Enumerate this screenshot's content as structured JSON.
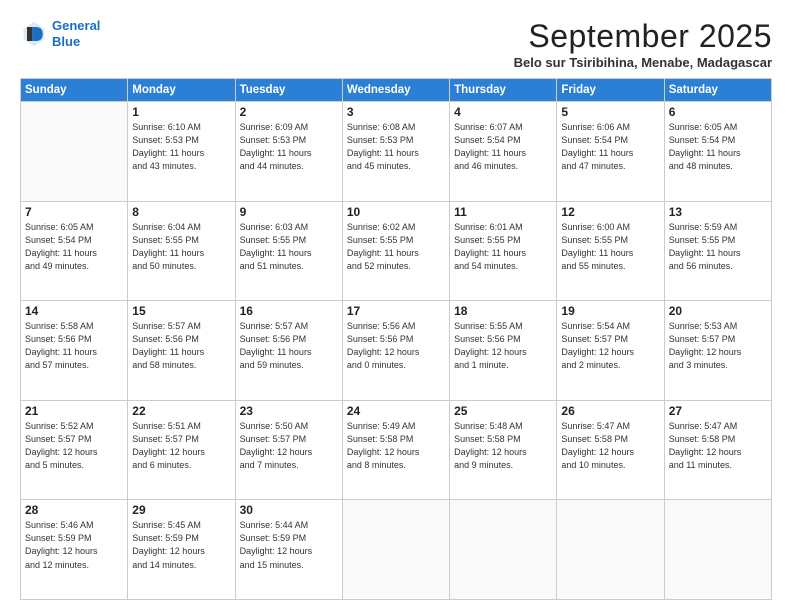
{
  "logo": {
    "line1": "General",
    "line2": "Blue"
  },
  "title": "September 2025",
  "location": "Belo sur Tsiribihina, Menabe, Madagascar",
  "headers": [
    "Sunday",
    "Monday",
    "Tuesday",
    "Wednesday",
    "Thursday",
    "Friday",
    "Saturday"
  ],
  "weeks": [
    [
      {
        "day": "",
        "info": ""
      },
      {
        "day": "1",
        "info": "Sunrise: 6:10 AM\nSunset: 5:53 PM\nDaylight: 11 hours\nand 43 minutes."
      },
      {
        "day": "2",
        "info": "Sunrise: 6:09 AM\nSunset: 5:53 PM\nDaylight: 11 hours\nand 44 minutes."
      },
      {
        "day": "3",
        "info": "Sunrise: 6:08 AM\nSunset: 5:53 PM\nDaylight: 11 hours\nand 45 minutes."
      },
      {
        "day": "4",
        "info": "Sunrise: 6:07 AM\nSunset: 5:54 PM\nDaylight: 11 hours\nand 46 minutes."
      },
      {
        "day": "5",
        "info": "Sunrise: 6:06 AM\nSunset: 5:54 PM\nDaylight: 11 hours\nand 47 minutes."
      },
      {
        "day": "6",
        "info": "Sunrise: 6:05 AM\nSunset: 5:54 PM\nDaylight: 11 hours\nand 48 minutes."
      }
    ],
    [
      {
        "day": "7",
        "info": "Sunrise: 6:05 AM\nSunset: 5:54 PM\nDaylight: 11 hours\nand 49 minutes."
      },
      {
        "day": "8",
        "info": "Sunrise: 6:04 AM\nSunset: 5:55 PM\nDaylight: 11 hours\nand 50 minutes."
      },
      {
        "day": "9",
        "info": "Sunrise: 6:03 AM\nSunset: 5:55 PM\nDaylight: 11 hours\nand 51 minutes."
      },
      {
        "day": "10",
        "info": "Sunrise: 6:02 AM\nSunset: 5:55 PM\nDaylight: 11 hours\nand 52 minutes."
      },
      {
        "day": "11",
        "info": "Sunrise: 6:01 AM\nSunset: 5:55 PM\nDaylight: 11 hours\nand 54 minutes."
      },
      {
        "day": "12",
        "info": "Sunrise: 6:00 AM\nSunset: 5:55 PM\nDaylight: 11 hours\nand 55 minutes."
      },
      {
        "day": "13",
        "info": "Sunrise: 5:59 AM\nSunset: 5:55 PM\nDaylight: 11 hours\nand 56 minutes."
      }
    ],
    [
      {
        "day": "14",
        "info": "Sunrise: 5:58 AM\nSunset: 5:56 PM\nDaylight: 11 hours\nand 57 minutes."
      },
      {
        "day": "15",
        "info": "Sunrise: 5:57 AM\nSunset: 5:56 PM\nDaylight: 11 hours\nand 58 minutes."
      },
      {
        "day": "16",
        "info": "Sunrise: 5:57 AM\nSunset: 5:56 PM\nDaylight: 11 hours\nand 59 minutes."
      },
      {
        "day": "17",
        "info": "Sunrise: 5:56 AM\nSunset: 5:56 PM\nDaylight: 12 hours\nand 0 minutes."
      },
      {
        "day": "18",
        "info": "Sunrise: 5:55 AM\nSunset: 5:56 PM\nDaylight: 12 hours\nand 1 minute."
      },
      {
        "day": "19",
        "info": "Sunrise: 5:54 AM\nSunset: 5:57 PM\nDaylight: 12 hours\nand 2 minutes."
      },
      {
        "day": "20",
        "info": "Sunrise: 5:53 AM\nSunset: 5:57 PM\nDaylight: 12 hours\nand 3 minutes."
      }
    ],
    [
      {
        "day": "21",
        "info": "Sunrise: 5:52 AM\nSunset: 5:57 PM\nDaylight: 12 hours\nand 5 minutes."
      },
      {
        "day": "22",
        "info": "Sunrise: 5:51 AM\nSunset: 5:57 PM\nDaylight: 12 hours\nand 6 minutes."
      },
      {
        "day": "23",
        "info": "Sunrise: 5:50 AM\nSunset: 5:57 PM\nDaylight: 12 hours\nand 7 minutes."
      },
      {
        "day": "24",
        "info": "Sunrise: 5:49 AM\nSunset: 5:58 PM\nDaylight: 12 hours\nand 8 minutes."
      },
      {
        "day": "25",
        "info": "Sunrise: 5:48 AM\nSunset: 5:58 PM\nDaylight: 12 hours\nand 9 minutes."
      },
      {
        "day": "26",
        "info": "Sunrise: 5:47 AM\nSunset: 5:58 PM\nDaylight: 12 hours\nand 10 minutes."
      },
      {
        "day": "27",
        "info": "Sunrise: 5:47 AM\nSunset: 5:58 PM\nDaylight: 12 hours\nand 11 minutes."
      }
    ],
    [
      {
        "day": "28",
        "info": "Sunrise: 5:46 AM\nSunset: 5:59 PM\nDaylight: 12 hours\nand 12 minutes."
      },
      {
        "day": "29",
        "info": "Sunrise: 5:45 AM\nSunset: 5:59 PM\nDaylight: 12 hours\nand 14 minutes."
      },
      {
        "day": "30",
        "info": "Sunrise: 5:44 AM\nSunset: 5:59 PM\nDaylight: 12 hours\nand 15 minutes."
      },
      {
        "day": "",
        "info": ""
      },
      {
        "day": "",
        "info": ""
      },
      {
        "day": "",
        "info": ""
      },
      {
        "day": "",
        "info": ""
      }
    ]
  ]
}
